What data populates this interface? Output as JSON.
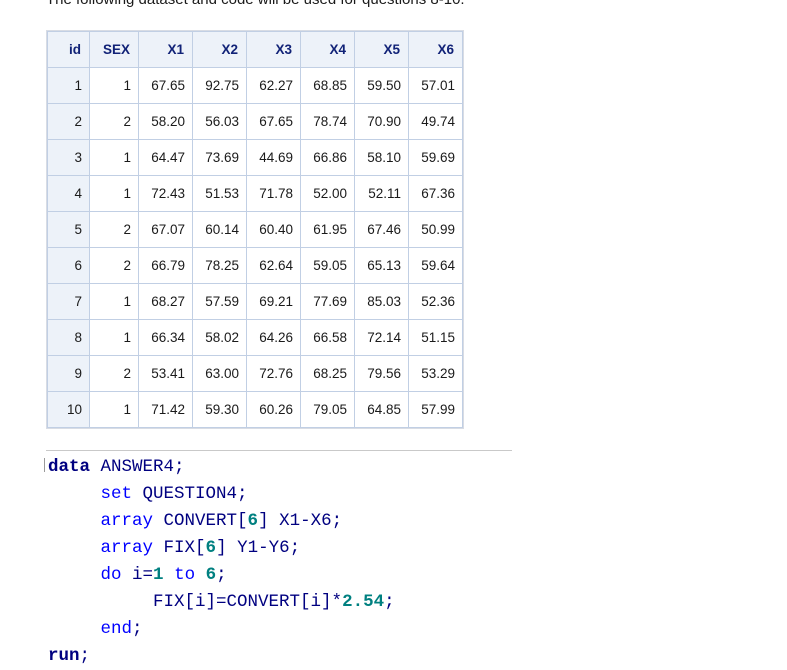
{
  "intro": "The following dataset and code will be used for questions 8-10.",
  "table": {
    "headers": [
      "id",
      "SEX",
      "X1",
      "X2",
      "X3",
      "X4",
      "X5",
      "X6"
    ],
    "rows": [
      [
        "1",
        "1",
        "67.65",
        "92.75",
        "62.27",
        "68.85",
        "59.50",
        "57.01"
      ],
      [
        "2",
        "2",
        "58.20",
        "56.03",
        "67.65",
        "78.74",
        "70.90",
        "49.74"
      ],
      [
        "3",
        "1",
        "64.47",
        "73.69",
        "44.69",
        "66.86",
        "58.10",
        "59.69"
      ],
      [
        "4",
        "1",
        "72.43",
        "51.53",
        "71.78",
        "52.00",
        "52.11",
        "67.36"
      ],
      [
        "5",
        "2",
        "67.07",
        "60.14",
        "60.40",
        "61.95",
        "67.46",
        "50.99"
      ],
      [
        "6",
        "2",
        "66.79",
        "78.25",
        "62.64",
        "59.05",
        "65.13",
        "59.64"
      ],
      [
        "7",
        "1",
        "68.27",
        "57.59",
        "69.21",
        "77.69",
        "85.03",
        "52.36"
      ],
      [
        "8",
        "1",
        "66.34",
        "58.02",
        "64.26",
        "66.58",
        "72.14",
        "51.15"
      ],
      [
        "9",
        "2",
        "53.41",
        "63.00",
        "72.76",
        "68.25",
        "79.56",
        "53.29"
      ],
      [
        "10",
        "1",
        "71.42",
        "59.30",
        "60.26",
        "79.05",
        "64.85",
        "57.99"
      ]
    ]
  },
  "code": {
    "l1_kw": "data",
    "l1_rest": " ANSWER4;",
    "l2_indent": "     ",
    "l2_kw": "set",
    "l2_rest": " QUESTION4;",
    "l3_kw": "array",
    "l3_a": " CONVERT[",
    "l3_num": "6",
    "l3_b": "] X1-X6;",
    "l4_kw": "array",
    "l4_a": " FIX[",
    "l4_num": "6",
    "l4_b": "] Y1-Y6;",
    "l5_kw": "do",
    "l5_a": " i=",
    "l5_n1": "1",
    "l5_to": " to ",
    "l5_n2": "6",
    "l5_end": ";",
    "l6_indent": "          ",
    "l6_a": "FIX[i]=CONVERT[i]*",
    "l6_num": "2.54",
    "l6_end": ";",
    "l7_kw": "end",
    "l7_end": ";",
    "l8_kw": "run",
    "l8_end": ";"
  }
}
